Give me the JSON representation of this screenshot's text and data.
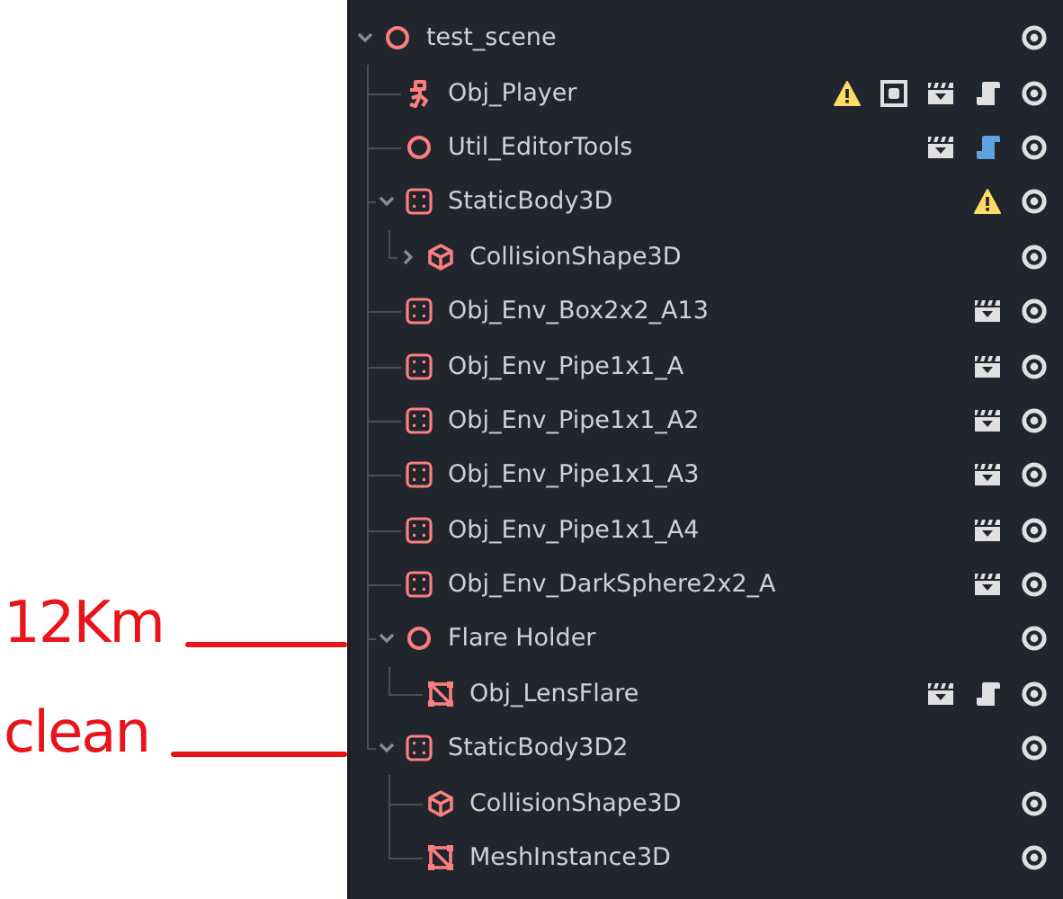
{
  "tree": [
    {
      "name": "test_scene",
      "kind": "node",
      "expanded": true,
      "visible": true,
      "children": [
        {
          "name": "Obj_Player",
          "kind": "character",
          "visible": true,
          "badges": [
            {
              "kind": "warning"
            },
            {
              "kind": "group"
            },
            {
              "kind": "scene"
            },
            {
              "kind": "script"
            }
          ]
        },
        {
          "name": "Util_EditorTools",
          "kind": "node",
          "visible": true,
          "badges": [
            {
              "kind": "scene"
            },
            {
              "kind": "tool_script"
            }
          ]
        },
        {
          "name": "StaticBody3D",
          "kind": "body",
          "expanded": true,
          "visible": true,
          "badges": [
            {
              "kind": "warning"
            }
          ],
          "children": [
            {
              "name": "CollisionShape3D",
              "kind": "shape",
              "expanded": false,
              "visible": true
            }
          ]
        },
        {
          "name": "Obj_Env_Box2x2_A13",
          "kind": "body",
          "visible": true,
          "badges": [
            {
              "kind": "scene"
            }
          ]
        },
        {
          "name": "Obj_Env_Pipe1x1_A",
          "kind": "body",
          "visible": true,
          "badges": [
            {
              "kind": "scene"
            }
          ]
        },
        {
          "name": "Obj_Env_Pipe1x1_A2",
          "kind": "body",
          "visible": true,
          "badges": [
            {
              "kind": "scene"
            }
          ]
        },
        {
          "name": "Obj_Env_Pipe1x1_A3",
          "kind": "body",
          "visible": true,
          "badges": [
            {
              "kind": "scene"
            }
          ]
        },
        {
          "name": "Obj_Env_Pipe1x1_A4",
          "kind": "body",
          "visible": true,
          "badges": [
            {
              "kind": "scene"
            }
          ]
        },
        {
          "name": "Obj_Env_DarkSphere2x2_A",
          "kind": "body",
          "visible": true,
          "badges": [
            {
              "kind": "scene"
            }
          ]
        },
        {
          "name": "Flare Holder",
          "kind": "node",
          "expanded": true,
          "visible": true,
          "annotation": "12Km",
          "children": [
            {
              "name": "Obj_LensFlare",
              "kind": "mesh",
              "visible": true,
              "badges": [
                {
                  "kind": "scene"
                },
                {
                  "kind": "script"
                }
              ]
            }
          ]
        },
        {
          "name": "StaticBody3D2",
          "kind": "body",
          "expanded": true,
          "visible": true,
          "annotation": "clean",
          "children": [
            {
              "name": "CollisionShape3D",
              "kind": "shape",
              "visible": true
            },
            {
              "name": "MeshInstance3D",
              "kind": "mesh",
              "visible": true
            }
          ]
        }
      ]
    }
  ]
}
